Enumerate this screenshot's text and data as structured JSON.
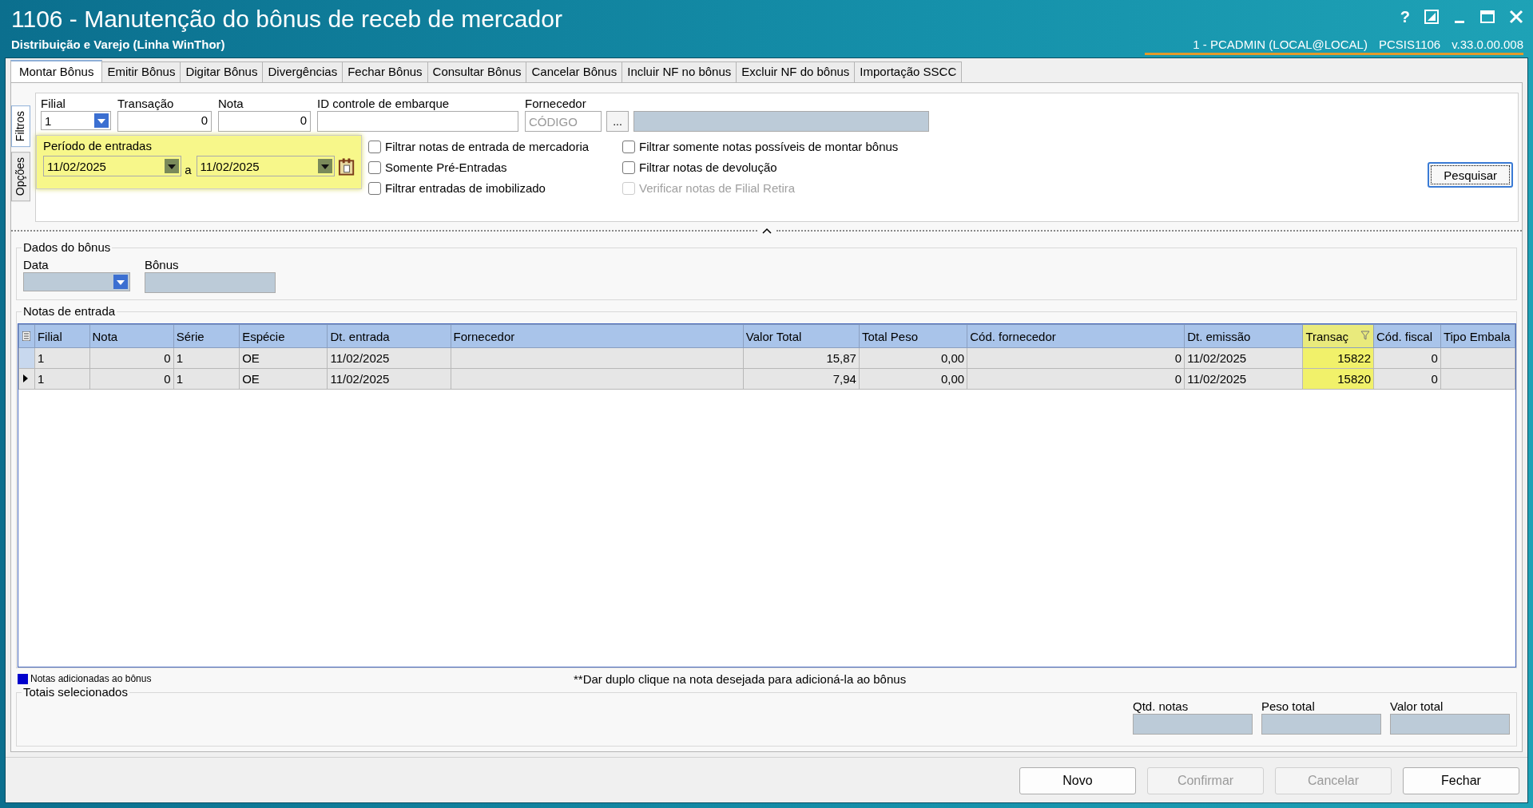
{
  "window": {
    "title": "1106 - Manutenção do bônus de receb de mercador",
    "subtitle": "Distribuição e Varejo (Linha WinThor)",
    "help": "?",
    "user": "1 - PCADMIN (LOCAL@LOCAL)",
    "program": "PCSIS1106",
    "version": "v.33.0.00.008"
  },
  "tabs": [
    {
      "label": "Montar Bônus",
      "selected": true
    },
    {
      "label": "Emitir Bônus",
      "selected": false
    },
    {
      "label": "Digitar Bônus",
      "selected": false
    },
    {
      "label": "Divergências",
      "selected": false
    },
    {
      "label": "Fechar Bônus",
      "selected": false
    },
    {
      "label": "Consultar Bônus",
      "selected": false
    },
    {
      "label": "Cancelar Bônus",
      "selected": false
    },
    {
      "label": "Incluir NF no bônus",
      "selected": false
    },
    {
      "label": "Excluir NF do bônus",
      "selected": false
    },
    {
      "label": "Importação SSCC",
      "selected": false
    }
  ],
  "side_tabs": [
    {
      "label": "Filtros",
      "selected": true
    },
    {
      "label": "Opções",
      "selected": false
    }
  ],
  "filters": {
    "filial": {
      "label": "Filial",
      "value": "1"
    },
    "transacao": {
      "label": "Transação",
      "value": "0"
    },
    "nota": {
      "label": "Nota",
      "value": "0"
    },
    "id_embarque": {
      "label": "ID controle de embarque"
    },
    "fornecedor": {
      "label": "Fornecedor",
      "placeholder": "CÓDIGO",
      "button": "..."
    }
  },
  "periodo": {
    "label": "Período de entradas",
    "from": "11/02/2025",
    "separator": "a",
    "to": "11/02/2025",
    "highlighted": true
  },
  "checkbox_columns": [
    [
      {
        "label": "Filtrar notas de entrada de mercadoria",
        "checked": false,
        "disabled": false
      },
      {
        "label": "Somente Pré-Entradas",
        "checked": false,
        "disabled": false
      },
      {
        "label": "Filtrar entradas de imobilizado",
        "checked": false,
        "disabled": false
      }
    ],
    [
      {
        "label": "Filtrar somente notas possíveis de montar bônus",
        "checked": false,
        "disabled": false
      },
      {
        "label": "Filtrar notas de devolução",
        "checked": false,
        "disabled": false
      },
      {
        "label": "Verificar notas de Filial Retira",
        "checked": false,
        "disabled": true
      }
    ]
  ],
  "search_button": "Pesquisar",
  "dados_bonus": {
    "title": "Dados do bônus",
    "data_label": "Data",
    "bonus_label": "Bônus"
  },
  "notas": {
    "title": "Notas de entrada",
    "columns": [
      {
        "label": "Filial",
        "kind": "text",
        "highlighted": false
      },
      {
        "label": "Nota",
        "kind": "number",
        "highlighted": false
      },
      {
        "label": "Série",
        "kind": "text",
        "highlighted": false
      },
      {
        "label": "Espécie",
        "kind": "text",
        "highlighted": false
      },
      {
        "label": "Dt. entrada",
        "kind": "text",
        "highlighted": false
      },
      {
        "label": "Fornecedor",
        "kind": "text",
        "highlighted": false
      },
      {
        "label": "Valor Total",
        "kind": "number",
        "highlighted": false
      },
      {
        "label": "Total Peso",
        "kind": "number",
        "highlighted": false
      },
      {
        "label": "Cód. fornecedor",
        "kind": "number",
        "highlighted": false
      },
      {
        "label": "Dt. emissão",
        "kind": "text",
        "highlighted": false
      },
      {
        "label": "Transaç",
        "kind": "number",
        "highlighted": true
      },
      {
        "label": "Cód. fiscal",
        "kind": "number",
        "highlighted": false
      },
      {
        "label": "Tipo Embala",
        "kind": "text",
        "highlighted": false
      }
    ],
    "rows": [
      {
        "current": false,
        "cells": [
          "1",
          "0",
          "1",
          "OE",
          "11/02/2025",
          "",
          "15,87",
          "0,00",
          "0",
          "11/02/2025",
          "15822",
          "0",
          ""
        ]
      },
      {
        "current": true,
        "cells": [
          "1",
          "0",
          "1",
          "OE",
          "11/02/2025",
          "",
          "7,94",
          "0,00",
          "0",
          "11/02/2025",
          "15820",
          "0",
          ""
        ]
      }
    ]
  },
  "legend": {
    "color": "#0000cc",
    "label": "Notas adicionadas ao bônus",
    "hint": "**Dar duplo clique na nota desejada para adicioná-la ao bônus"
  },
  "totais": {
    "title": "Totais selecionados",
    "fields": [
      "Qtd. notas",
      "Peso total",
      "Valor total"
    ]
  },
  "buttons": [
    {
      "label": "Novo",
      "disabled": false
    },
    {
      "label": "Confirmar",
      "disabled": true
    },
    {
      "label": "Cancelar",
      "disabled": true
    },
    {
      "label": "Fechar",
      "disabled": false
    }
  ]
}
